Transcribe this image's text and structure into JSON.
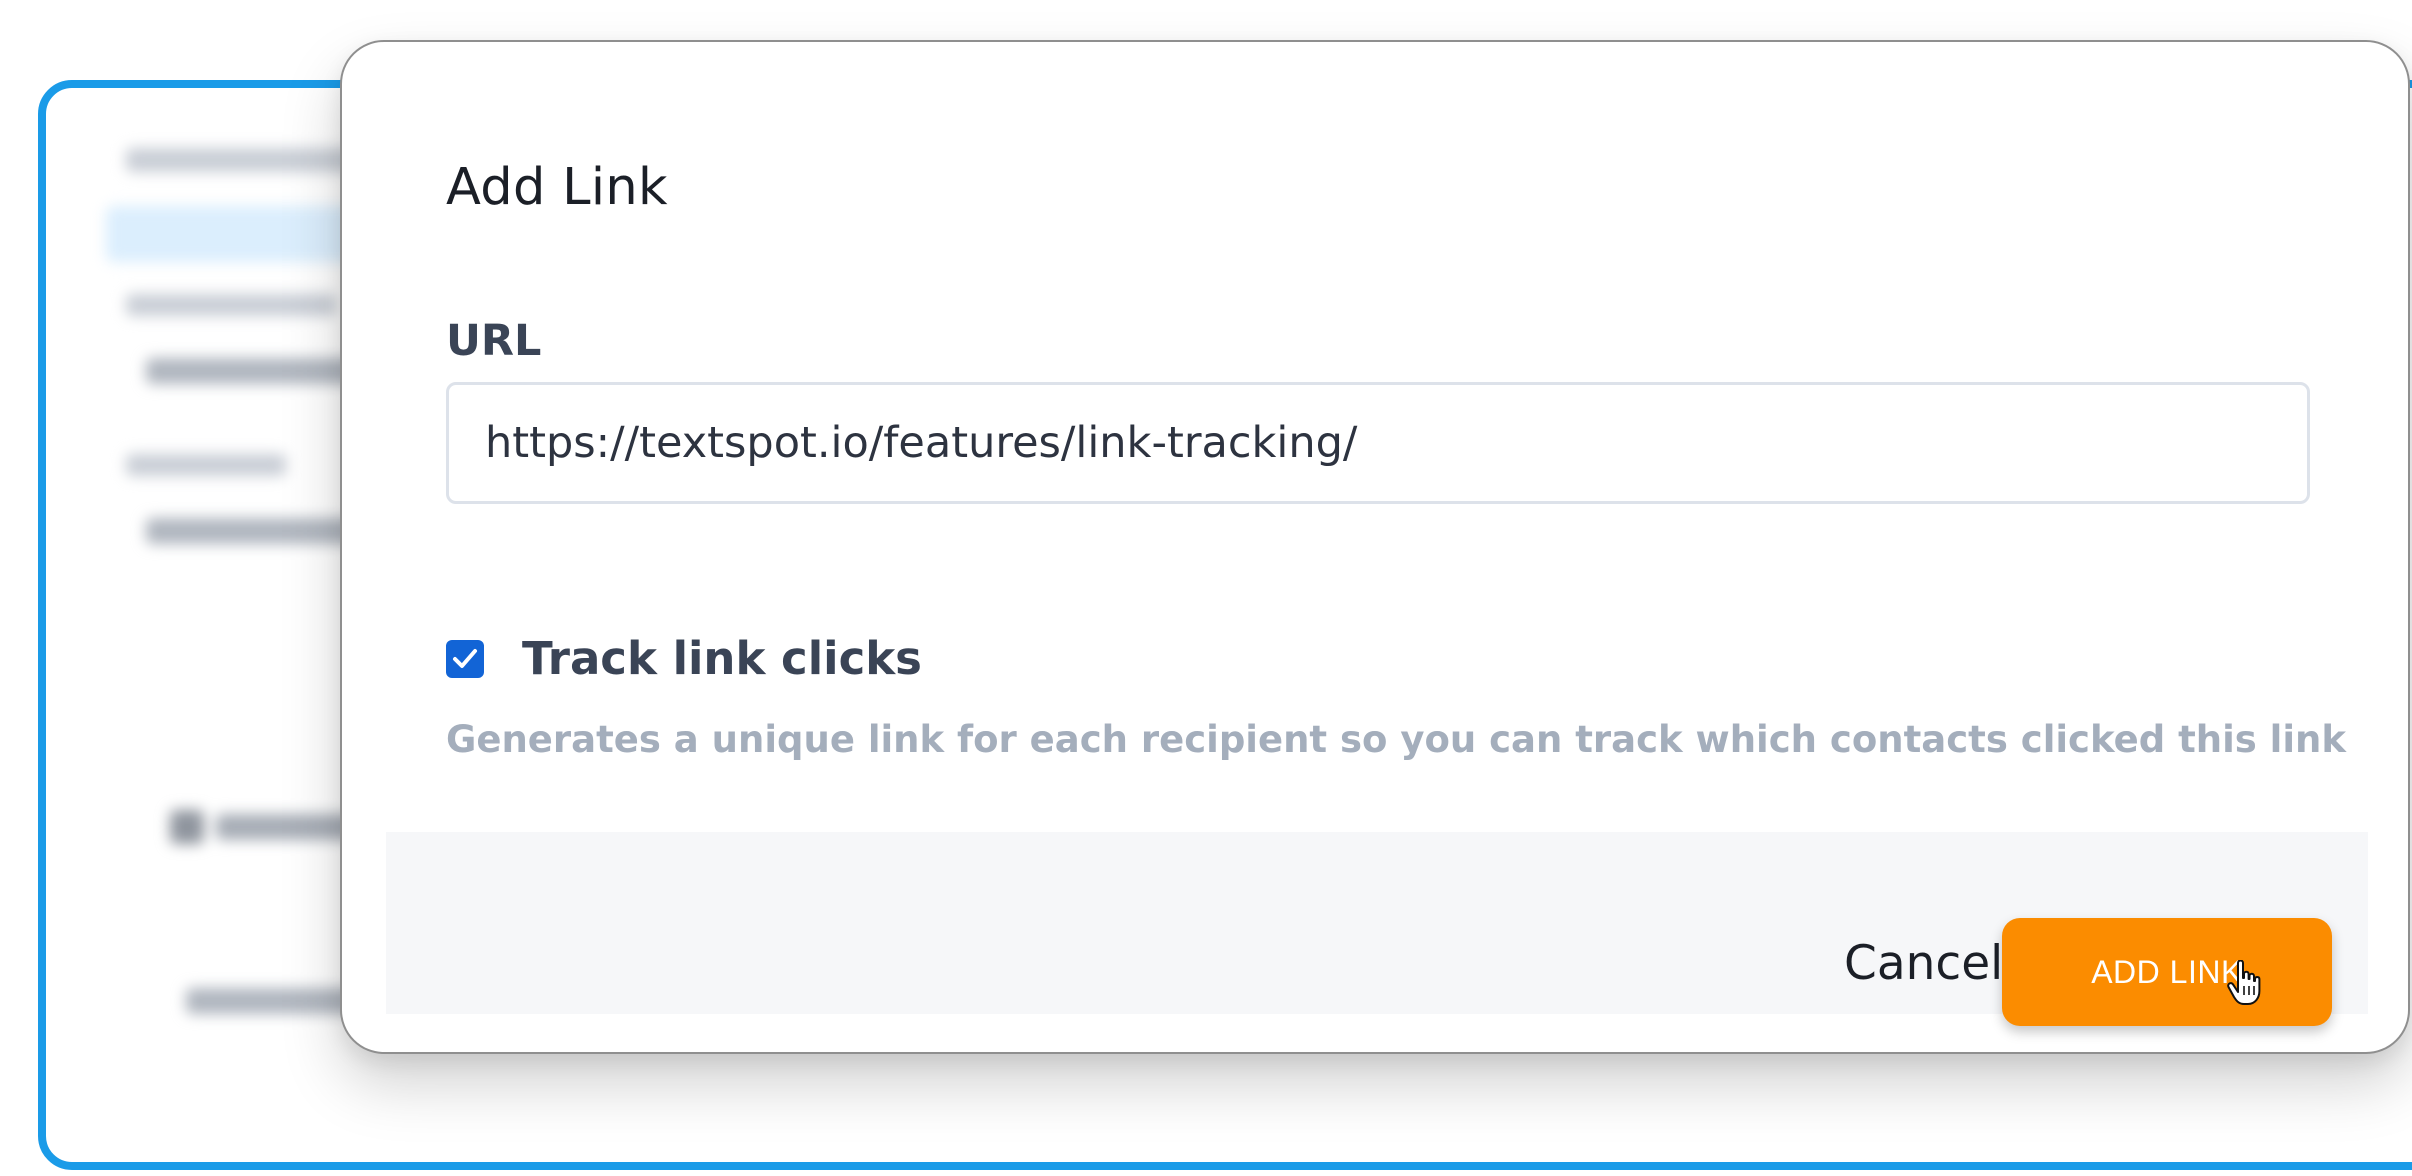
{
  "modal": {
    "title": "Add Link",
    "url_label": "URL",
    "url_value": "https://textspot.io/features/link-tracking/",
    "track_checked": true,
    "track_label": "Track link clicks",
    "help_text": "Generates a unique link for each recipient so you can track which contacts clicked this link",
    "cancel_label": "Cancel",
    "add_label": "ADD LINK"
  },
  "colors": {
    "background_card_border": "#1a9be8",
    "primary_button": "#fb8c00",
    "checkbox": "#1264d6",
    "footer_background": "#f6f7f9"
  },
  "icons": {
    "checkbox": "checkmark-icon",
    "cursor": "hand-pointer-icon"
  }
}
